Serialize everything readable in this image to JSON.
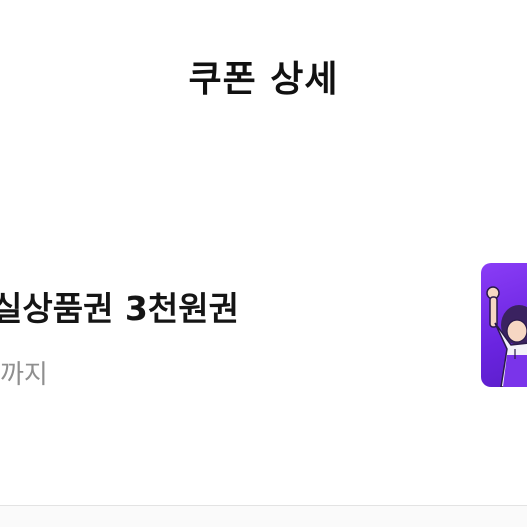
{
  "header": {
    "title": "쿠폰 상세"
  },
  "coupon": {
    "name": "실상품권 3천원권",
    "expiry_suffix": "까지",
    "thumbnail_icon": "cheering-character-icon"
  },
  "colors": {
    "thumbnail_bg": "#7b2ff0",
    "title_text": "#111111",
    "muted_text": "#8f8f8f"
  }
}
